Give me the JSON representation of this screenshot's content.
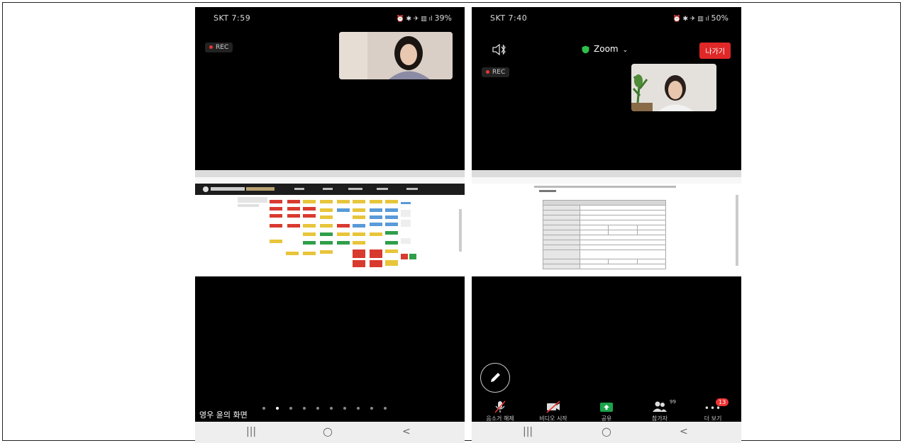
{
  "left_phone": {
    "status": {
      "carrier_time": "SKT 7:59",
      "right": "39%"
    },
    "rec_label": "REC",
    "caption": "영우 윤의 화면",
    "page_dots": 10,
    "active_dot": 1
  },
  "right_phone": {
    "status": {
      "carrier_time": "SKT 7:40",
      "right": "50%"
    },
    "title": "Zoom",
    "leave_label": "나가기",
    "rec_label": "REC",
    "toolbar": [
      {
        "key": "mute",
        "label": "음소거 해제",
        "icon": "mic-muted-icon"
      },
      {
        "key": "video",
        "label": "비디오 시작",
        "icon": "video-off-icon"
      },
      {
        "key": "share",
        "label": "공유",
        "icon": "share-icon"
      },
      {
        "key": "participants",
        "label": "참가자",
        "icon": "participants-icon",
        "count": "99"
      },
      {
        "key": "more",
        "label": "더 보기",
        "icon": "more-icon",
        "badge": "13"
      }
    ]
  },
  "colors": {
    "rec_dot": "#e33333",
    "leave": "#e02828",
    "share_green": "#1aa34a",
    "shield_green": "#2fbf4a"
  }
}
